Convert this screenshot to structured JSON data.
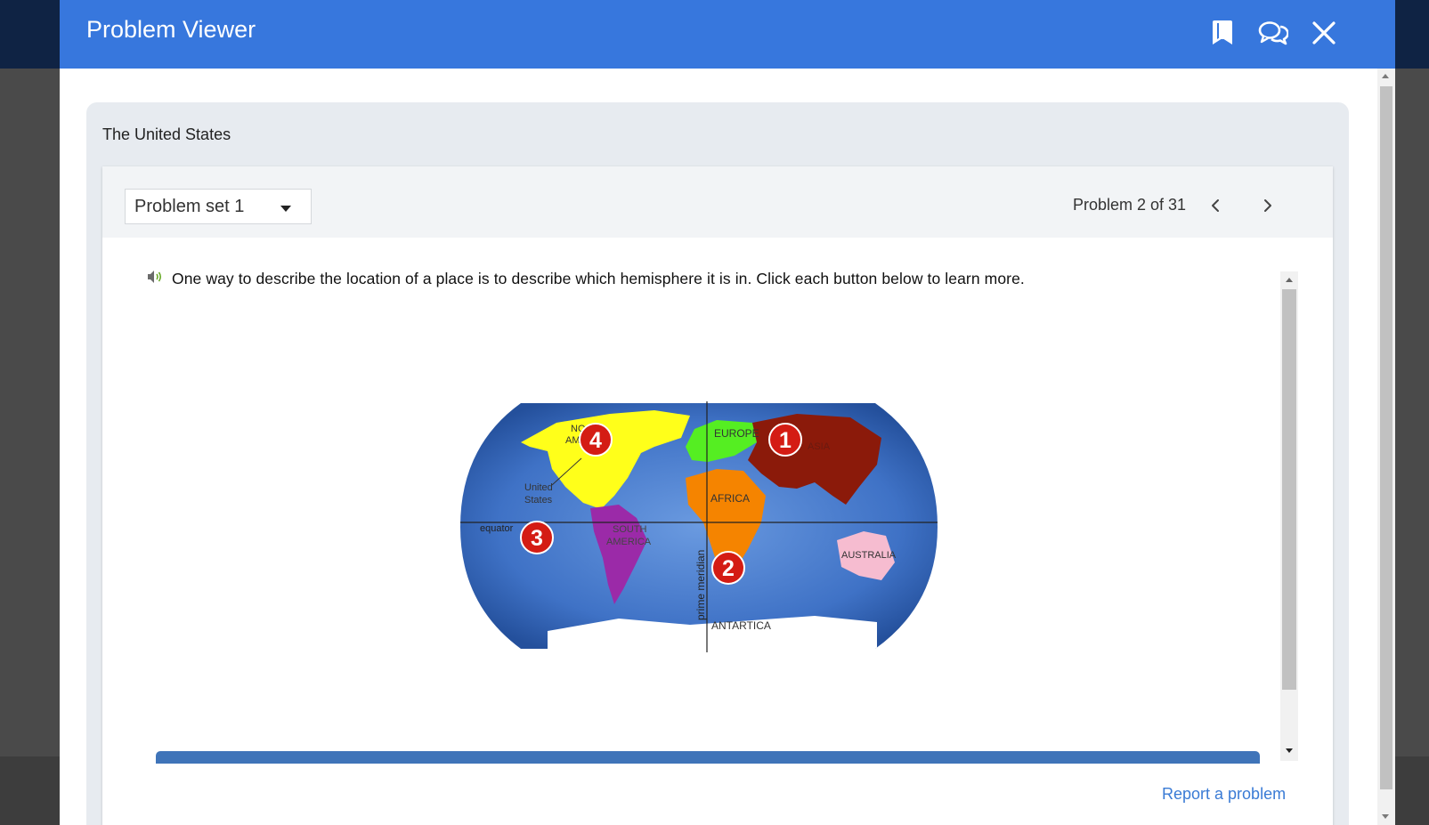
{
  "modal": {
    "title": "Problem Viewer",
    "icons": [
      "bookmark-icon",
      "comments-icon",
      "close-icon"
    ]
  },
  "assignment": {
    "title": "The United States"
  },
  "toolbar": {
    "problem_set": "Problem set 1",
    "counter": "Problem 2 of 31"
  },
  "problem": {
    "question": "One way to describe the location of a place is to describe which hemisphere it is in. Click each button below to learn more.",
    "map": {
      "labels": {
        "north_america_1": "NO",
        "north_america_2": "AM",
        "united_states_1": "United",
        "united_states_2": "States",
        "europe": "EUROPE",
        "asia": "ASIA",
        "africa": "AFRICA",
        "south_america_1": "SOUTH",
        "south_america_2": "AMERICA",
        "australia": "AUSTRALIA",
        "antarctica": "ANTARTICA",
        "equator": "equator",
        "prime_meridian": "prime meridian"
      },
      "buttons": [
        "1",
        "2",
        "3",
        "4"
      ]
    }
  },
  "footer": {
    "report": "Report a problem"
  },
  "colors": {
    "header": "#3777dd",
    "ocean": "#3a6fc4",
    "north_america": "#ffff1a",
    "europe": "#55ee22",
    "asia": "#8b1a0a",
    "africa": "#f58400",
    "south_america": "#9b2aa8",
    "australia": "#f6bcd0",
    "antarctica": "#ffffff",
    "marker": "#d41c14"
  }
}
